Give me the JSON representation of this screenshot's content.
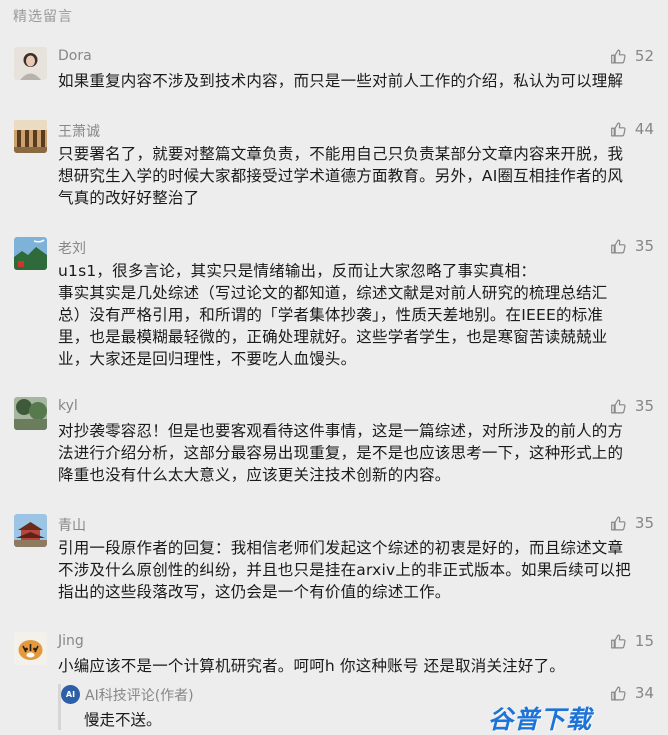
{
  "section_title": "精选留言",
  "comments": [
    {
      "name": "Dora",
      "likes": "52",
      "text": "如果重复内容不涉及到技术内容，而只是一些对前人工作的介绍，私认为可以理解"
    },
    {
      "name": "王萧诚",
      "likes": "44",
      "text": "只要署名了，就要对整篇文章负责，不能用自己只负责某部分文章内容来开脱，我\n想研究生入学的时候大家都接受过学术道德方面教育。另外，AI圈互相挂作者的风\n气真的改好好整治了"
    },
    {
      "name": "老刘",
      "likes": "35",
      "text": "u1s1，很多言论，其实只是情绪输出，反而让大家忽略了事实真相：\n事实其实是几处综述（写过论文的都知道，综述文献是对前人研究的梳理总结汇\n总）没有严格引用，和所谓的「学者集体抄袭」，性质天差地别。在IEEE的标准\n里，也是最模糊最轻微的，正确处理就好。这些学者学生，也是寒窗苦读兢兢业\n业，大家还是回归理性，不要吃人血馒头。"
    },
    {
      "name": "kyl",
      "likes": "35",
      "text": "对抄袭零容忍！但是也要客观看待这件事情，这是一篇综述，对所涉及的前人的方\n法进行介绍分析，这部分最容易出现重复，是不是也应该思考一下，这种形式上的\n降重也没有什么太大意义，应该更关注技术创新的内容。"
    },
    {
      "name": "青山",
      "likes": "35",
      "text": "引用一段原作者的回复：我相信老师们发起这个综述的初衷是好的，而且综述文章\n不涉及什么原创性的纠纷，并且也只是挂在arxiv上的非正式版本。如果后续可以把\n指出的这些段落改写，这仍会是一个有价值的综述工作。"
    },
    {
      "name": "Jing",
      "likes": "15",
      "text": "小编应该不是一个计算机研究者。呵呵h 你这种账号 还是取消关注好了。"
    }
  ],
  "author_reply": {
    "badge": "AI",
    "name": "AI科技评论(作者)",
    "likes": "34",
    "text": "慢走不送。"
  },
  "watermark": "谷普下载",
  "colors": {
    "background": "#ededed",
    "meta_gray": "#878787",
    "watermark_blue": "#1d74d8"
  },
  "icons": [
    "thumbs-up-icon"
  ]
}
